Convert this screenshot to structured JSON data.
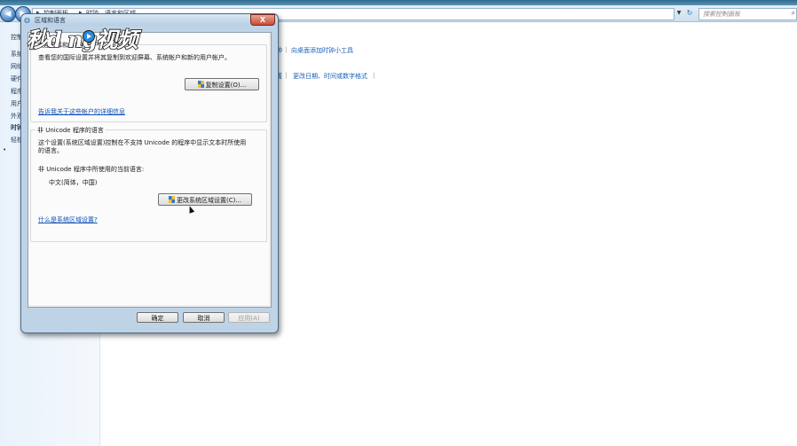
{
  "control_panel": {
    "nav_back_icon": "back-arrow-icon",
    "nav_forward_icon": "forward-arrow-icon",
    "breadcrumb": [
      "控制面板",
      "时钟、语言和区域"
    ],
    "search_placeholder": "搜索控制面板",
    "sidebar_items": [
      "控制",
      "系统",
      "网络",
      "硬件",
      "程序",
      "用户",
      "外观",
      "时钟",
      "轻松"
    ],
    "content_links": {
      "gadget_tail": "钟",
      "add_clock_gadget": "向桌面添加时钟小工具",
      "region_tail": "置",
      "change_date_format": "更改日期、时间或数字格式"
    }
  },
  "dialog": {
    "title": "区域和语言",
    "close_label": "X",
    "welcome_group": {
      "title": "欢迎屏幕和新用户帐户",
      "description": "查看您的国际设置并将其复制到欢迎屏幕、系统帐户和新的用户帐户。",
      "copy_button": "复制设置(O)...",
      "more_link": "告诉我关于这些帐户的详细信息"
    },
    "unicode_group": {
      "title": "非 Unicode 程序的语言",
      "description_line1": "这个设置(系统区域设置)控制在不支持 Unicode 的程序中显示文本时所使用",
      "description_line2": "的语言。",
      "current_label": "非 Unicode 程序中所使用的当前语言:",
      "current_value": "中文(简体，中国)",
      "change_button": "更改系统区域设置(C)...",
      "help_link": "什么是系统区域设置?"
    },
    "buttons": {
      "ok": "确定",
      "cancel": "取消",
      "apply": "应用(A)"
    }
  },
  "watermark": {
    "text": "秒d ng视频"
  },
  "colors": {
    "link": "#0d4fb5",
    "dialog_frame": "#bfd3e6",
    "close_red": "#c64d33"
  }
}
